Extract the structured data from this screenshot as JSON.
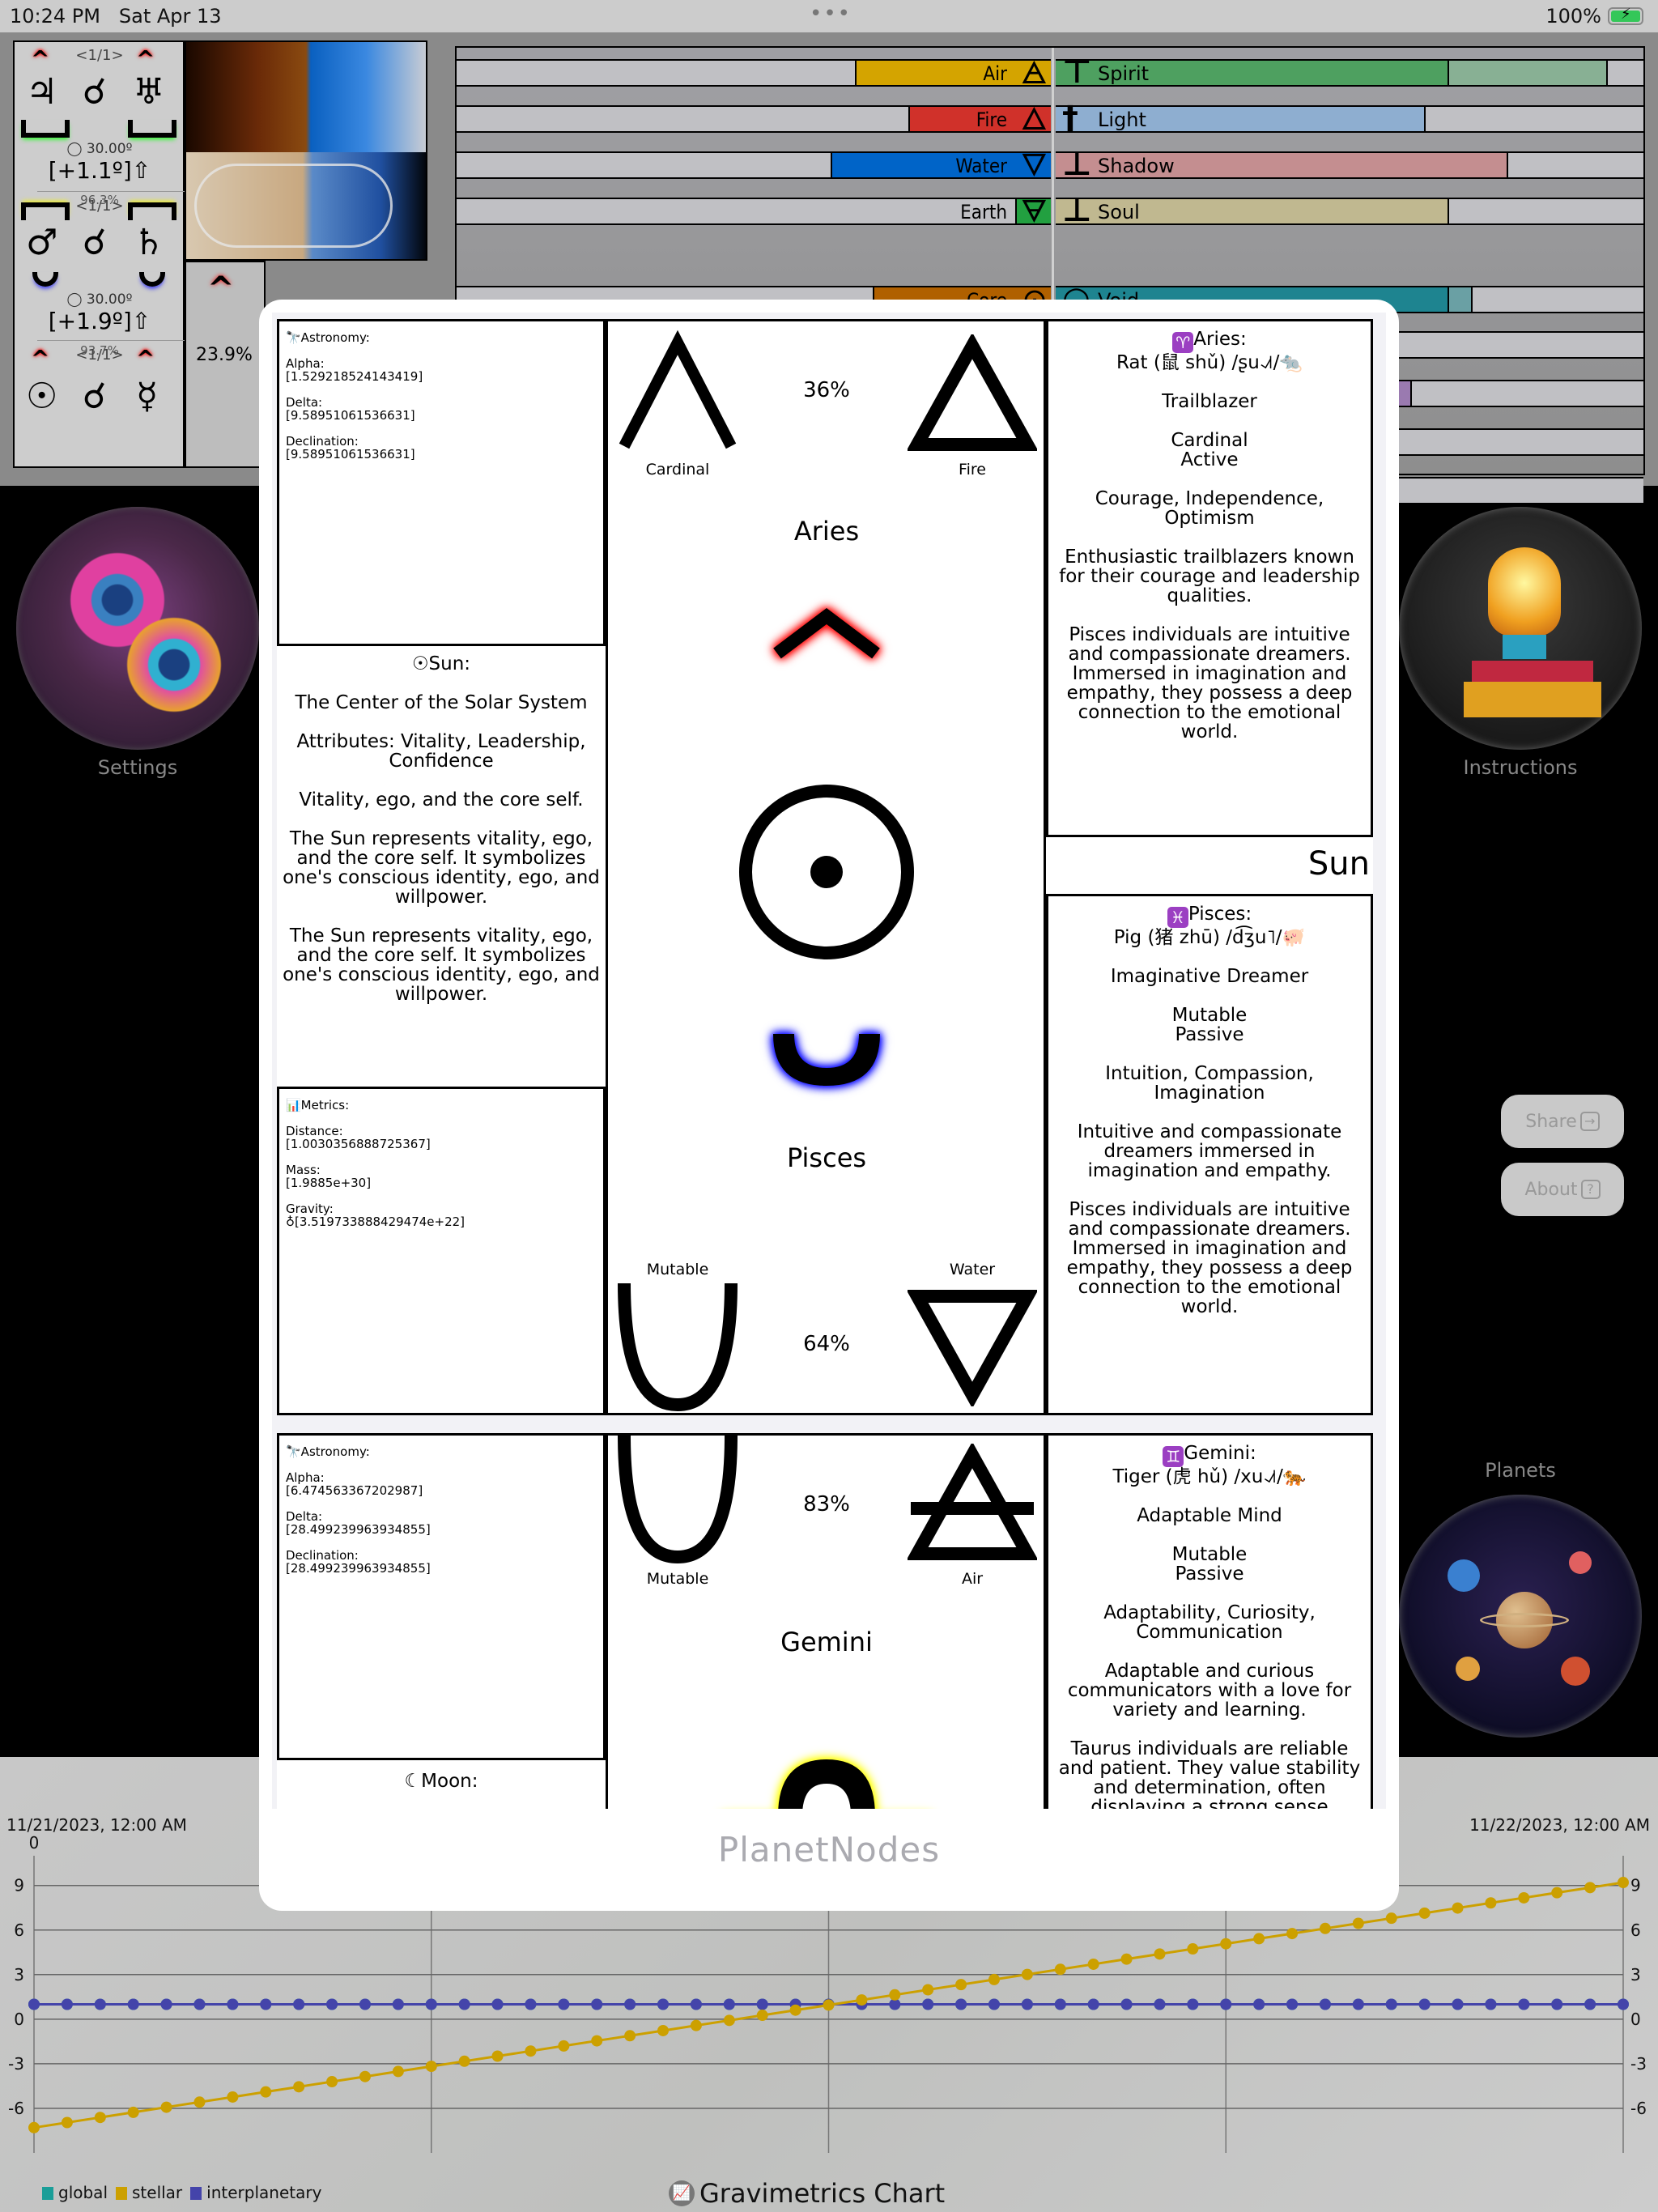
{
  "status_bar": {
    "time": "10:24 PM",
    "date": "Sat Apr 13",
    "dots": "•••",
    "battery_text": "100%",
    "battery_level": 1.0,
    "battery_icon": "battery-charging-icon"
  },
  "planet_panel": {
    "groups": [
      {
        "page": "<1/1>",
        "left_symbol": "♃",
        "link_symbol": "☌",
        "right_symbol": "♅",
        "left_indicator": "chevron-red",
        "right_indicator": "chevron-red",
        "bottom_indicator": "step-green",
        "degree": "◯ 30.00º",
        "delta": "[+1.1º]⇧",
        "percent": "96.3%"
      },
      {
        "page": "<1/1>",
        "left_symbol": "♂",
        "link_symbol": "☌",
        "right_symbol": "♄",
        "left_indicator": "step-yellow",
        "right_indicator": "step-yellow",
        "bottom_indicator": "cup-blue",
        "degree": "◯ 30.00º",
        "delta": "[+1.9º]⇧",
        "percent": "93.7%"
      },
      {
        "page": "<1/1>",
        "left_symbol": "☉",
        "link_symbol": "☌",
        "right_symbol": "☿",
        "left_indicator": "chevron-red",
        "right_indicator": "chevron-red"
      }
    ],
    "side_percent": "23.9%"
  },
  "bars": {
    "left": [
      {
        "label": "Air",
        "symbol": "🜁",
        "color": "#d4a400",
        "fill": 0.33
      },
      {
        "label": "Fire",
        "symbol": "🜂",
        "color": "#d0312a",
        "fill": 0.24
      },
      {
        "label": "Water",
        "symbol": "🜄",
        "color": "#0064c8",
        "fill": 0.37
      },
      {
        "label": "Earth",
        "symbol": "🜃",
        "color": "#22a040",
        "fill": 0.06
      },
      {
        "label": "Core",
        "symbol": "⊙",
        "color": "#b06000",
        "fill": 0.3
      }
    ],
    "right": [
      {
        "label": "Spirit",
        "symbol": "⊤",
        "color": "#4ea060",
        "color2": "#88b094",
        "fill": 0.67,
        "fill2": 0.94
      },
      {
        "label": "Light",
        "symbol": "†",
        "color": "#8eaed0",
        "fill": 0.63
      },
      {
        "label": "Shadow",
        "symbol": "⊥",
        "color": "#c48e90",
        "fill": 0.77
      },
      {
        "label": "Soul",
        "symbol": "⊥",
        "color": "#c0b890",
        "fill": 0.67
      },
      {
        "label": "Void",
        "symbol": "○",
        "color": "#1e8490",
        "color2": "#6aa0a4",
        "fill": 0.67,
        "fill2": 0.71
      }
    ]
  },
  "side_buttons": {
    "settings": {
      "label": "Settings",
      "icon": "gears-icon"
    },
    "instructions": {
      "label": "Instructions",
      "icon": "lightbulb-books-icon"
    },
    "planets": {
      "label": "Planets",
      "icon": "planets-icon"
    },
    "share": {
      "label": "Share",
      "icon": "→"
    },
    "about": {
      "label": "About",
      "icon": "?"
    }
  },
  "modal": {
    "title": "PlanetNodes",
    "nodes": [
      {
        "astronomy": {
          "header": "🔭Astronomy:",
          "fields": [
            {
              "label": "Alpha:",
              "value": "[1.529218524143419]"
            },
            {
              "label": "Delta:",
              "value": "[9.58951061536631]"
            },
            {
              "label": "Declination:",
              "value": "[9.58951061536631]"
            }
          ]
        },
        "planet": {
          "header": "☉Sun:",
          "name": "Sun",
          "paragraphs": [
            "The Center of the Solar System",
            "Attributes: Vitality, Leadership, Confidence",
            "Vitality, ego, and the core self.",
            "The Sun represents vitality, ego, and the core self. It symbolizes one's conscious identity, ego, and willpower.",
            "The Sun represents vitality, ego, and the core self. It symbolizes one's conscious identity, ego, and willpower."
          ]
        },
        "metrics": {
          "header": "📊Metrics:",
          "fields": [
            {
              "label": "Distance:",
              "value": "[1.0030356888725367]"
            },
            {
              "label": "Mass:",
              "value": "[1.9885e+30]"
            },
            {
              "label": "Gravity:",
              "value": "♁[3.519733888429474e+22]"
            }
          ]
        },
        "top_sign": {
          "name": "Aries",
          "modality": "Cardinal",
          "element": "Fire",
          "percent": "36%",
          "badge": "♈",
          "header": "Aries:",
          "animal": "Rat (鼠 shǔ) /ʂu˨˩˦/🐀",
          "paragraphs": [
            "Trailblazer",
            "Cardinal\nActive",
            "Courage, Independence, Optimism",
            "Enthusiastic trailblazers known for their courage and leadership qualities.",
            "Pisces individuals are intuitive and compassionate dreamers. Immersed in imagination and empathy, they possess a deep connection to the emotional world."
          ]
        },
        "bottom_sign": {
          "name": "Pisces",
          "modality": "Mutable",
          "element": "Water",
          "percent": "64%",
          "badge": "♓",
          "header": "Pisces:",
          "animal": "Pig (猪 zhū) /d͡ʒu˥/🐖",
          "paragraphs": [
            "Imaginative Dreamer",
            "Mutable\nPassive",
            "Intuition, Compassion, Imagination",
            "Intuitive and compassionate dreamers immersed in imagination and empathy.",
            "Pisces individuals are intuitive and compassionate dreamers. Immersed in imagination and empathy, they possess a deep connection to the emotional world."
          ]
        }
      },
      {
        "astronomy": {
          "header": "🔭Astronomy:",
          "fields": [
            {
              "label": "Alpha:",
              "value": "[6.474563367202987]"
            },
            {
              "label": "Delta:",
              "value": "[28.499239963934855]"
            },
            {
              "label": "Declination:",
              "value": "[28.499239963934855]"
            }
          ]
        },
        "planet": {
          "header": "☾Moon:"
        },
        "top_sign": {
          "name": "Gemini",
          "modality": "Mutable",
          "element": "Air",
          "percent": "83%",
          "badge": "♊",
          "header": "Gemini:",
          "animal": "Tiger (虎 hǔ) /xu˨˩˦/🐅",
          "paragraphs": [
            "Adaptable Mind",
            "Mutable\nPassive",
            "Adaptability, Curiosity, Communication",
            "Adaptable and curious communicators with a love for variety and learning.",
            "Taurus individuals are reliable and patient. They value stability and determination, often displaying a strong sense"
          ]
        }
      }
    ]
  },
  "chart_data": {
    "type": "line",
    "title": "Gravimetrics Chart",
    "x_start_label": "11/21/2023, 12:00 AM",
    "x_end_label": "11/22/2023, 12:00 AM",
    "y_top_label": "0",
    "ylim": [
      -9,
      11
    ],
    "yticks": [
      -6,
      -3,
      0,
      3,
      6,
      9
    ],
    "grid": true,
    "legend_position": "bottom-left",
    "points_per_series": 49,
    "series": [
      {
        "name": "global",
        "color": "#1a9e98",
        "start": 1.0,
        "end": 1.0
      },
      {
        "name": "stellar",
        "color": "#cca000",
        "start": -7.3,
        "end": 9.2
      },
      {
        "name": "interplanetary",
        "color": "#4444aa",
        "start": 1.0,
        "end": 1.0
      }
    ]
  }
}
